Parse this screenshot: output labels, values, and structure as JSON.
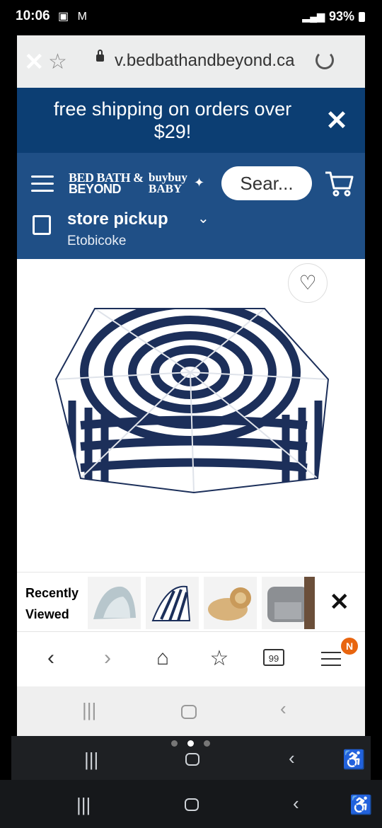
{
  "status_bar": {
    "time": "10:06",
    "battery": "93%"
  },
  "browser": {
    "url": "v.bedbathandbeyond.ca"
  },
  "promo": {
    "text": "free shipping on orders over $29!"
  },
  "header": {
    "logo_line1": "BED BATH &",
    "logo_line2": "BEYOND",
    "logo2_line1": "buybuy",
    "logo2_line2": "BABY",
    "search_placeholder": "Sear...",
    "store_pickup": "store pickup",
    "store_location": "Etobicoke"
  },
  "recently_viewed": {
    "label_line1": "Recently",
    "label_line2": "Viewed"
  },
  "toolbar": {
    "tabs_count": "99",
    "menu_badge": "N"
  },
  "colors": {
    "promo_bg": "#0c3e73",
    "header_bg": "#1f4f86",
    "umbrella_stripe": "#1c2f5a",
    "badge": "#e8650f"
  }
}
